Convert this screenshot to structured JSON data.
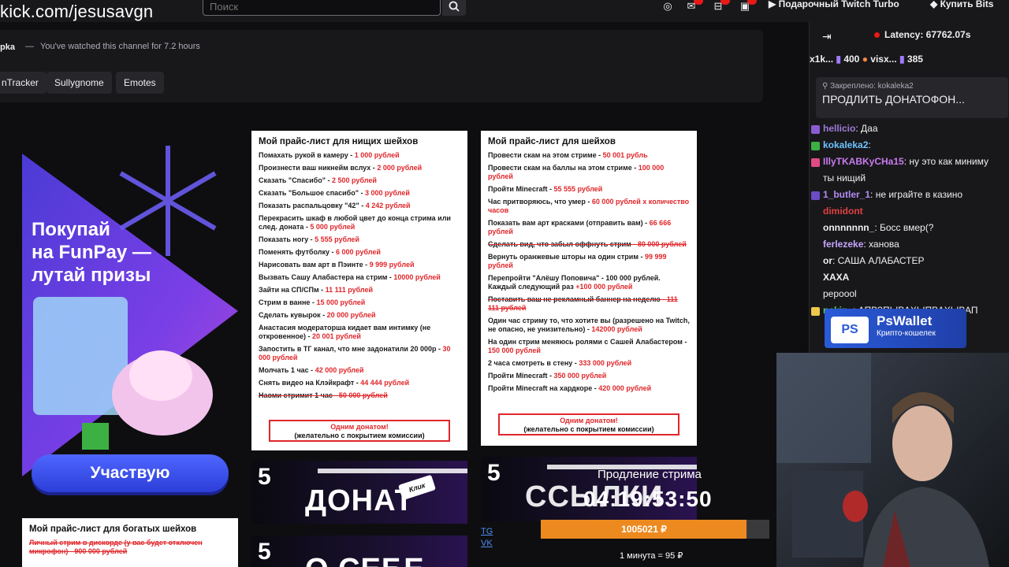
{
  "topbar": {
    "url": "kick.com/jesusavgn",
    "search_placeholder": "Поиск",
    "turbo_label": "Подарочный Twitch Turbo",
    "bits_label": "Купить Bits"
  },
  "about": {
    "name": "рka",
    "watched": "You've watched this channel for 7.2 hours",
    "tabs": [
      "nTracker",
      "Sullygnome",
      "Emotes"
    ]
  },
  "funpay": {
    "line1": "Покупай",
    "line2": "на FunPay —",
    "line3": "лутай призы",
    "cta": "Участвую"
  },
  "price_poor": {
    "title": "Мой прайс-лист для нищих шейхов",
    "rows": [
      {
        "text": "Помахать рукой в камеру - ",
        "amount": "1 000 рублей"
      },
      {
        "text": "Произнести ваш никнейм вслух - ",
        "amount": "2 000 рублей"
      },
      {
        "text": "Сказать \"Спасибо\" - ",
        "amount": "2 500 рублей"
      },
      {
        "text": "Сказать \"Большое спасибо\" - ",
        "amount": "3 000 рублей"
      },
      {
        "text": "Показать распальцовку \"42\" - ",
        "amount": "4 242 рублей"
      },
      {
        "text": "Перекрасить шкаф в любой цвет до конца стрима или след. доната - ",
        "amount": "5 000 рублей"
      },
      {
        "text": "Показать ногу - ",
        "amount": "5 555 рублей"
      },
      {
        "text": "Поменять футболку - ",
        "amount": "6 000 рублей"
      },
      {
        "text": "Нарисовать вам арт в Пэинте - ",
        "amount": "9 999 рублей"
      },
      {
        "text": "Вызвать Сашу Алабастера на стрим - ",
        "amount": "10000 рублей"
      },
      {
        "text": "Зайти на СП/СПм - ",
        "amount": "11 111 рублей"
      },
      {
        "text": "Стрим в ванне - ",
        "amount": "15 000 рублей"
      },
      {
        "text": "Сделать кувырок - ",
        "amount": "20 000 рублей"
      },
      {
        "text": "Анастасия модераторша кидает вам интимку (не откровенное) - ",
        "amount": "20 001 рублей"
      },
      {
        "text": "Запостить в ТГ канал, что мне задонатили 20 000р - ",
        "amount": "30 000 рублей"
      },
      {
        "text": "Молчать 1 час - ",
        "amount": "42 000 рублей"
      },
      {
        "text": "Снять видео на Клэйкрафт - ",
        "amount": "44 444 рублей"
      },
      {
        "text": "Наоми стримит 1 час - ",
        "amount": "50 000 рублей",
        "strike": true
      }
    ],
    "box1": "Одним донатом!",
    "box2": "(желательно с покрытием комиссии)"
  },
  "price_sheikh": {
    "title": "Мой прайс-лист для шейхов",
    "rows": [
      {
        "text": "Провести скам на этом стриме - ",
        "amount": "50 001 рубль"
      },
      {
        "text": "Провести скам на баллы на этом стриме - ",
        "amount": "100 000 рублей"
      },
      {
        "text": "Пройти Minecraft - ",
        "amount": "55 555 рублей"
      },
      {
        "text": "Час притворяюсь, что умер - ",
        "amount": "60 000 рублей х количество часов"
      },
      {
        "text": "Показать вам арт красками (отправить вам) - ",
        "amount": "66 666 рублей"
      },
      {
        "text": "Сделать вид, что забыл оффнуть стрим - ",
        "amount": "80 000 рублей",
        "strike": true
      },
      {
        "text": "Вернуть оранжевые шторы на один стрим - ",
        "amount": "99 999 рублей"
      },
      {
        "text": "Перепройти \"Алёшу Поповича\" - 100 000 рублей. Каждый следующий раз ",
        "amount": "+100 000 рублей"
      },
      {
        "text": "Поставить ваш не рекламный баннер на неделю - ",
        "amount": "111 111 рублей",
        "strike": true
      },
      {
        "text": "Один час стриму то, что хотите вы (разрешено на Twitch, не опасно, не унизительно) - ",
        "amount": "142000 рублей"
      },
      {
        "text": "На один стрим меняюсь ролями с Сашей Алабастером - ",
        "amount": "150 000 рублей"
      },
      {
        "text": "2 часа смотреть в стену - ",
        "amount": "333 000 рублей"
      },
      {
        "text": "Пройти Minecraft - ",
        "amount": "350 000 рублей"
      },
      {
        "text": "Пройти Minecraft на хардкоре - ",
        "amount": "420 000 рублей"
      }
    ],
    "box1": "Одним донатом!",
    "box2": "(желательно с покрытием комиссии)"
  },
  "price_rich": {
    "title": "Мой прайс-лист для богатых шейхов",
    "row1": "Личный стрим в дискорде (у вас будет отключен микрофон) - 900 000 рублей"
  },
  "banners": {
    "num": "5",
    "donate": "ДОНАТ",
    "klik": "Клик",
    "links": "ССЫЛКИ",
    "about": "О СЕБЕ"
  },
  "social_links": [
    "TG",
    "VK"
  ],
  "extension": {
    "label": "Продление стрима",
    "timer": "04:19:53:50",
    "amount": "1005021 ₽",
    "progress": 0.9,
    "rate": "1 минута = 95 ₽"
  },
  "chat": {
    "latency": "Latency: 67762.07s",
    "gifters": [
      {
        "name": "x1k...",
        "count": "400"
      },
      {
        "name": "visx...",
        "count": "385"
      }
    ],
    "pinned_meta": "Закреплено: kokaleka2",
    "pinned_msg": "ПРОДЛИТЬ ДОНАТОФОН...",
    "messages": [
      {
        "user": "hellicio",
        "text": ": Даа",
        "color": "#9d7bd8",
        "badge": "#8a5cd1"
      },
      {
        "user": "kokaleka2",
        "text": ":",
        "color": "#6ec3ff",
        "badge": "#3cb043"
      },
      {
        "user": "IllyTKABKyCHa15",
        "text": ": ну это как миниму",
        "color": "#c97bf0",
        "badge": "#e24a85"
      },
      {
        "user": "",
        "text": "ты нищий",
        "color": "#efeff1",
        "badge": ""
      },
      {
        "user": "1_butler_1",
        "text": ": не играйте в казино",
        "color": "#b58cf2",
        "badge": "#6b4cc4"
      },
      {
        "user": "dimidont",
        "text": "",
        "color": "#e04040",
        "badge": ""
      },
      {
        "user": "onnnnnnn_",
        "text": ": Босс вмер(?",
        "color": "#efeff1",
        "badge": ""
      },
      {
        "user": "ferlezeke",
        "text": ": ханова",
        "color": "#c7a6ff",
        "badge": ""
      },
      {
        "user": "or",
        "text": ": САША АЛАБАСТЕР",
        "color": "#efeff1",
        "badge": ""
      },
      {
        "user": "ХАХА",
        "text": "",
        "color": "#efeff1",
        "badge": ""
      },
      {
        "user": "",
        "text": "рероool",
        "color": "#efeff1",
        "badge": ""
      },
      {
        "user": "nekin_",
        "text": ": АПВЗПЫВАХЫПВАХЫВАП",
        "color": "#5ec85e",
        "badge": "#ecc94b"
      }
    ]
  },
  "pswallet": {
    "logo": "PS",
    "title": "PsWallet",
    "subtitle": "Крипто-кошелек"
  }
}
